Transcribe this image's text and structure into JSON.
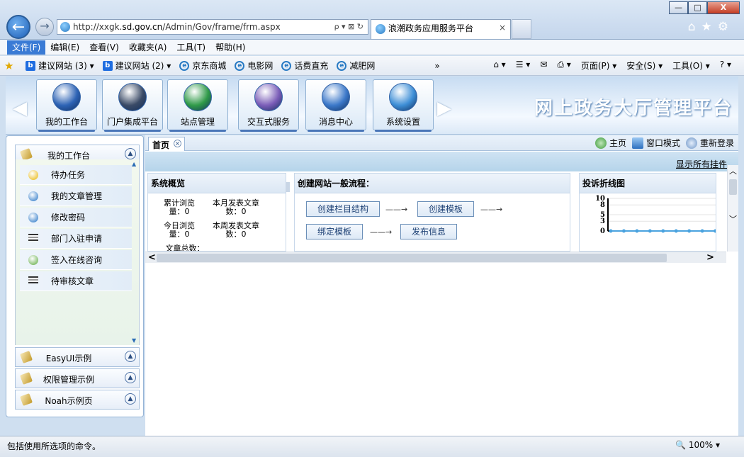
{
  "browser": {
    "window_buttons": {
      "minimize": "—",
      "maximize": "□",
      "close": "X"
    },
    "back_glyph": "←",
    "forward_glyph": "→",
    "address": {
      "prefix": "http://xxgk.",
      "domain": "sd.gov.cn",
      "path": "/Admin/Gov/frame/frm.aspx",
      "controls": "ρ ▾ ⊠ ↻"
    },
    "tab_title": "浪潮政务应用服务平台",
    "tab_close": "×",
    "right_tools": "⌂★⚙",
    "menu": [
      "文件(F)",
      "编辑(E)",
      "查看(V)",
      "收藏夹(A)",
      "工具(T)",
      "帮助(H)"
    ],
    "favorites": [
      {
        "icon": "b",
        "label": "建议网站 (3) ▾"
      },
      {
        "icon": "b",
        "label": "建议网站 (2) ▾"
      },
      {
        "icon": "e",
        "label": "京东商城"
      },
      {
        "icon": "e",
        "label": "电影网"
      },
      {
        "icon": "e",
        "label": "话费直充"
      },
      {
        "icon": "e",
        "label": "减肥网"
      }
    ],
    "favorites_more": "»",
    "commands": [
      "⌂ ▾",
      "☰ ▾",
      "✉",
      "⎙ ▾",
      "页面(P) ▾",
      "安全(S) ▾",
      "工具(O) ▾",
      "? ▾"
    ],
    "status_text": "包括使用所选项的命令。",
    "zoom": "🔍 100%  ▾"
  },
  "app": {
    "title": "网上政务大厅管理平台",
    "nav_prev": "◀",
    "nav_next": "▶",
    "modules": [
      {
        "label": "我的工作台",
        "color": "#2d63b5"
      },
      {
        "label": "门户集成平台",
        "color": "#3a4a66"
      },
      {
        "label": "站点管理",
        "color": "#2f9a48"
      },
      {
        "label": "交互式服务",
        "color": "#7b5db8"
      },
      {
        "label": "消息中心",
        "color": "#3b78c9"
      },
      {
        "label": "系统设置",
        "color": "#3d8ed6"
      }
    ],
    "sidebar": {
      "current_group": "我的工作台",
      "items": [
        "待办任务",
        "我的文章管理",
        "修改密码",
        "部门入驻申请",
        "签入在线咨询",
        "待审核文章"
      ],
      "groups": [
        "EasyUI示例",
        "权限管理示例",
        "Noah示例页"
      ]
    },
    "tabs": {
      "home": "首页",
      "close": "×"
    },
    "toplinks": [
      "主页",
      "窗口模式",
      "重新登录"
    ],
    "show_all": "显示所有挂件",
    "portlets": {
      "overview": {
        "title": "系统概览",
        "stats": [
          {
            "label": "累计浏览量：0"
          },
          {
            "label": "本月发表文章数：0"
          },
          {
            "label": "今日浏览量：0"
          },
          {
            "label": "本周发表文章数：0"
          },
          {
            "label": "文章总数："
          }
        ]
      },
      "flow": {
        "title": "创建网站一般流程：",
        "steps": [
          "创建栏目结构",
          "创建模板",
          "绑定模板",
          "发布信息"
        ],
        "arrow": "——→"
      },
      "complaint": {
        "title": "投诉折线图"
      }
    },
    "scroll": {
      "left": "<",
      "right": ">",
      "up": "︿",
      "down": "﹀"
    }
  },
  "chart_data": {
    "type": "line",
    "title": "投诉折线图",
    "ylim": [
      0,
      10
    ],
    "yticks": [
      0,
      3,
      5,
      8,
      10
    ],
    "series": [
      {
        "values": [
          0,
          0,
          0,
          0,
          0,
          0,
          0,
          0,
          0
        ]
      }
    ]
  }
}
